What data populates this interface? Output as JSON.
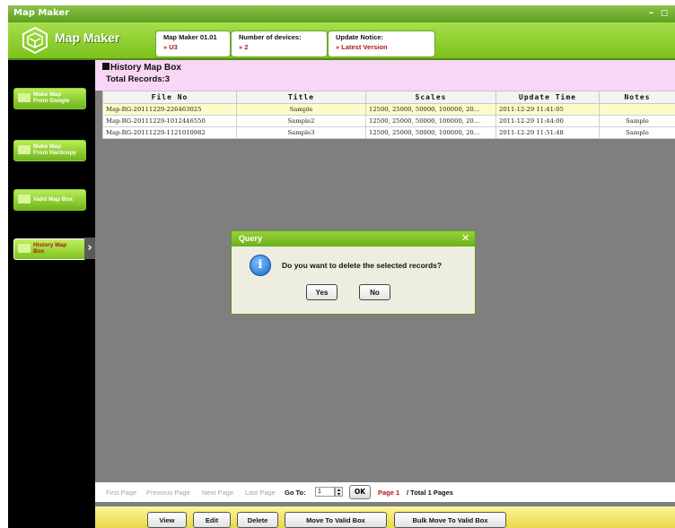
{
  "window": {
    "title": "Map Maker",
    "minimize_glyph": "–",
    "restore_glyph": "◻"
  },
  "header": {
    "app_name": "Map Maker",
    "logo_icon": "map-maker-logo-icon",
    "version": {
      "label": "Map Maker 01.01",
      "value": "» U3"
    },
    "devices": {
      "label": "Number of devices:",
      "value": "» 2"
    },
    "update": {
      "label": "Update Notice:",
      "value": "» Latest Version"
    }
  },
  "sidebar": {
    "items": [
      {
        "label_line1": "Make Map",
        "label_line2": "From Google",
        "icon": "folder-icon"
      },
      {
        "label_line1": "Make Map",
        "label_line2": "From Hardcopy",
        "icon": "folder-icon"
      },
      {
        "label_line1": "Valid Map Box",
        "label_line2": "",
        "icon": "folder-icon"
      },
      {
        "label_line1": "History Map",
        "label_line2": "Box",
        "icon": "folder-icon",
        "active": true
      }
    ],
    "active_arrow": "›"
  },
  "main": {
    "box_title": "History Map Box",
    "total_records": "Total Records:3",
    "table": {
      "columns": [
        "File No",
        "Title",
        "Scales",
        "Update Time",
        "Notes"
      ],
      "rows": [
        {
          "file_no": "Map-RG-20111229-226463025",
          "title": "Sample",
          "scales": "12500, 25000, 50000, 100000, 20...",
          "update_time": "2011-12-29 11:41:05",
          "notes": ""
        },
        {
          "file_no": "Map-RG-20111229-1012446550",
          "title": "Sample2",
          "scales": "12500, 25000, 50000, 100000, 20...",
          "update_time": "2011-12-29 11:44:00",
          "notes": "Sample"
        },
        {
          "file_no": "Map-RG-20111229-1121010982",
          "title": "Sample3",
          "scales": "12500, 25000, 50000, 100000, 20...",
          "update_time": "2011-12-29 11:51:48",
          "notes": "Sample"
        }
      ]
    },
    "pager": {
      "first": "First Page",
      "previous": "Previous Page",
      "next": "Next Page",
      "last": "Last Page",
      "goto_label": "Go To:",
      "goto_value": "1",
      "ok": "OK",
      "page": "Page 1",
      "total": "/ Total 1 Pages"
    },
    "toolbar": {
      "view": "View",
      "edit": "Edit",
      "delete": "Delete",
      "move": "Move To Valid Box",
      "bulk_move": "Bulk Move To Valid Box"
    }
  },
  "dialog": {
    "title": "Query",
    "close_glyph": "✕",
    "info_glyph": "i",
    "message": "Do you want to delete the selected records?",
    "yes": "Yes",
    "no": "No"
  },
  "colors": {
    "accent_green": "#7cc21c",
    "page_red": "#b01818",
    "box_header_pink": "#f8d6f5",
    "selected_row": "#fdfbc7",
    "toolbar_yellow": "#e8d74a"
  }
}
